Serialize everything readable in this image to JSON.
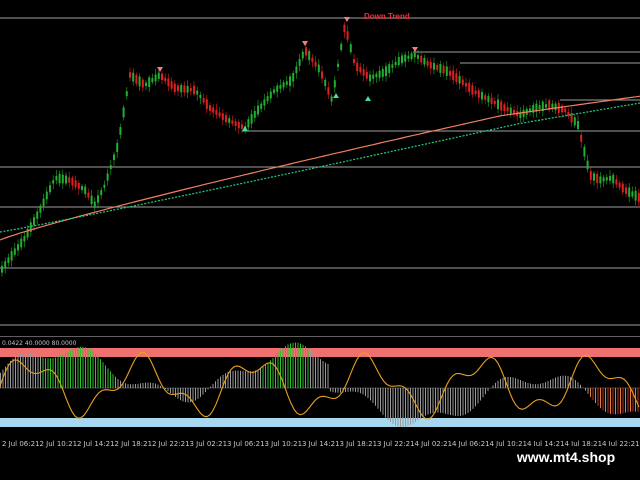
{
  "annotation": {
    "down_trend_label": "Down Trend"
  },
  "indicator_info": "0.0422 40.0000 80.0000",
  "time_axis": {
    "ticks": [
      "2 Jul 06:21",
      "2 Jul 10:21",
      "2 Jul 14:21",
      "2 Jul 18:21",
      "2 Jul 22:21",
      "3 Jul 02:21",
      "3 Jul 06:21",
      "3 Jul 10:21",
      "3 Jul 14:21",
      "3 Jul 18:21",
      "3 Jul 22:21",
      "4 Jul 02:21",
      "4 Jul 06:21",
      "4 Jul 10:21",
      "4 Jul 14:21",
      "4 Jul 18:21",
      "4 Jul 22:21"
    ]
  },
  "watermark": "www.mt4.shop",
  "colors": {
    "background": "#000000",
    "bull_candle": "#22b030",
    "bear_candle": "#e02020",
    "ma_fast": "#f08060",
    "ma_slow": "#20d080",
    "overbought_band": "#f07070",
    "oversold_band": "#a8d8f0",
    "osc_line": "#e8a020",
    "osc_fill_bull": "#30c030",
    "osc_fill_bear": "#c03020",
    "level_line": "#a0a0a0",
    "arrow_down": "#f08080",
    "arrow_up": "#40e0a0"
  },
  "icons": {
    "down_arrow": "down-arrow-icon",
    "up_arrow": "up-arrow-icon"
  }
}
